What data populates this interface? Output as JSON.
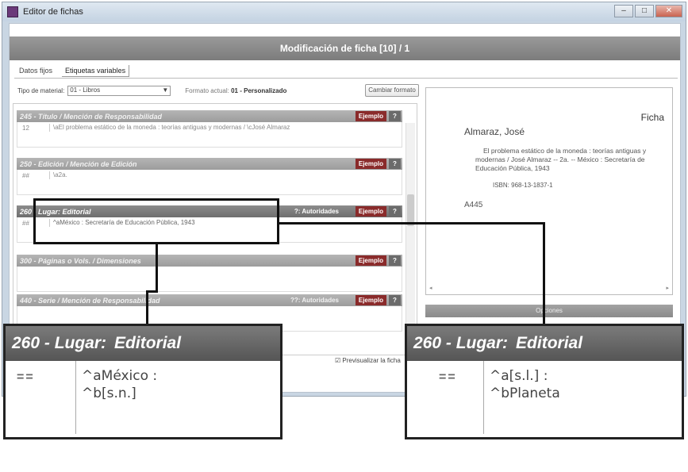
{
  "window": {
    "title": "Editor de fichas",
    "header": "Modificación de ficha [10] / 1"
  },
  "tabs": [
    {
      "label": "Datos fijos"
    },
    {
      "label": "Etiquetas variables"
    }
  ],
  "material": {
    "label": "Tipo de material:",
    "selected": "01 - Libros",
    "formato_label": "Formato actual:",
    "formato_value": "01 - Personalizado",
    "cambiar_button": "Cambiar formato"
  },
  "fields": [
    {
      "tag": "245 - Título / Mención de Responsabilidad",
      "indicators": "12",
      "value": "\\aEl problema estático de la moneda : teorías antiguas y modernas / \\cJosé Almaraz",
      "ejemplo": "Ejemplo",
      "help": "?"
    },
    {
      "tag": "250 - Edición / Mención de Edición",
      "indicators": "##",
      "value": "\\a2a.",
      "ejemplo": "Ejemplo",
      "help": "?"
    },
    {
      "tag": "260 - Lugar: Editorial",
      "indicators": "##",
      "value": "^aMéxico : Secretaría de Educación Pública, 1943",
      "ejemplo": "Ejemplo",
      "help": "?",
      "autoridades": "?: Autoridades"
    },
    {
      "tag": "300 - Páginas o Vols. / Dimensiones",
      "indicators": "",
      "value": "",
      "ejemplo": "Ejemplo",
      "help": "?"
    },
    {
      "tag": "440 - Serie / Mención de Responsabilidad",
      "indicators": "",
      "value": "",
      "ejemplo": "Ejemplo",
      "help": "?",
      "autoridades": "??: Autoridades"
    }
  ],
  "preview": {
    "checkbox_label": "Previsualizar la ficha"
  },
  "ficha": {
    "title": "Ficha",
    "author": "Almaraz, José",
    "description": "El problema estático de la moneda : teorías antiguas y modernas / José Almaraz -- 2a. -- México : Secretaría de Educación Pública, 1943",
    "isbn": "ISBN: 968-13-1837-1",
    "classification": "A445",
    "opciones_label": "Opciones"
  },
  "zoom_left": {
    "tag": "260 - Lugar:",
    "tag_second": "Editorial",
    "indicators": "==",
    "line1": "^aMéxico :",
    "line2": "^b[s.n.]"
  },
  "zoom_right": {
    "tag": "260 - Lugar:",
    "tag_second": "Editorial",
    "indicators": "==",
    "line1": "^a[s.l.] :",
    "line2": "^bPlaneta"
  }
}
